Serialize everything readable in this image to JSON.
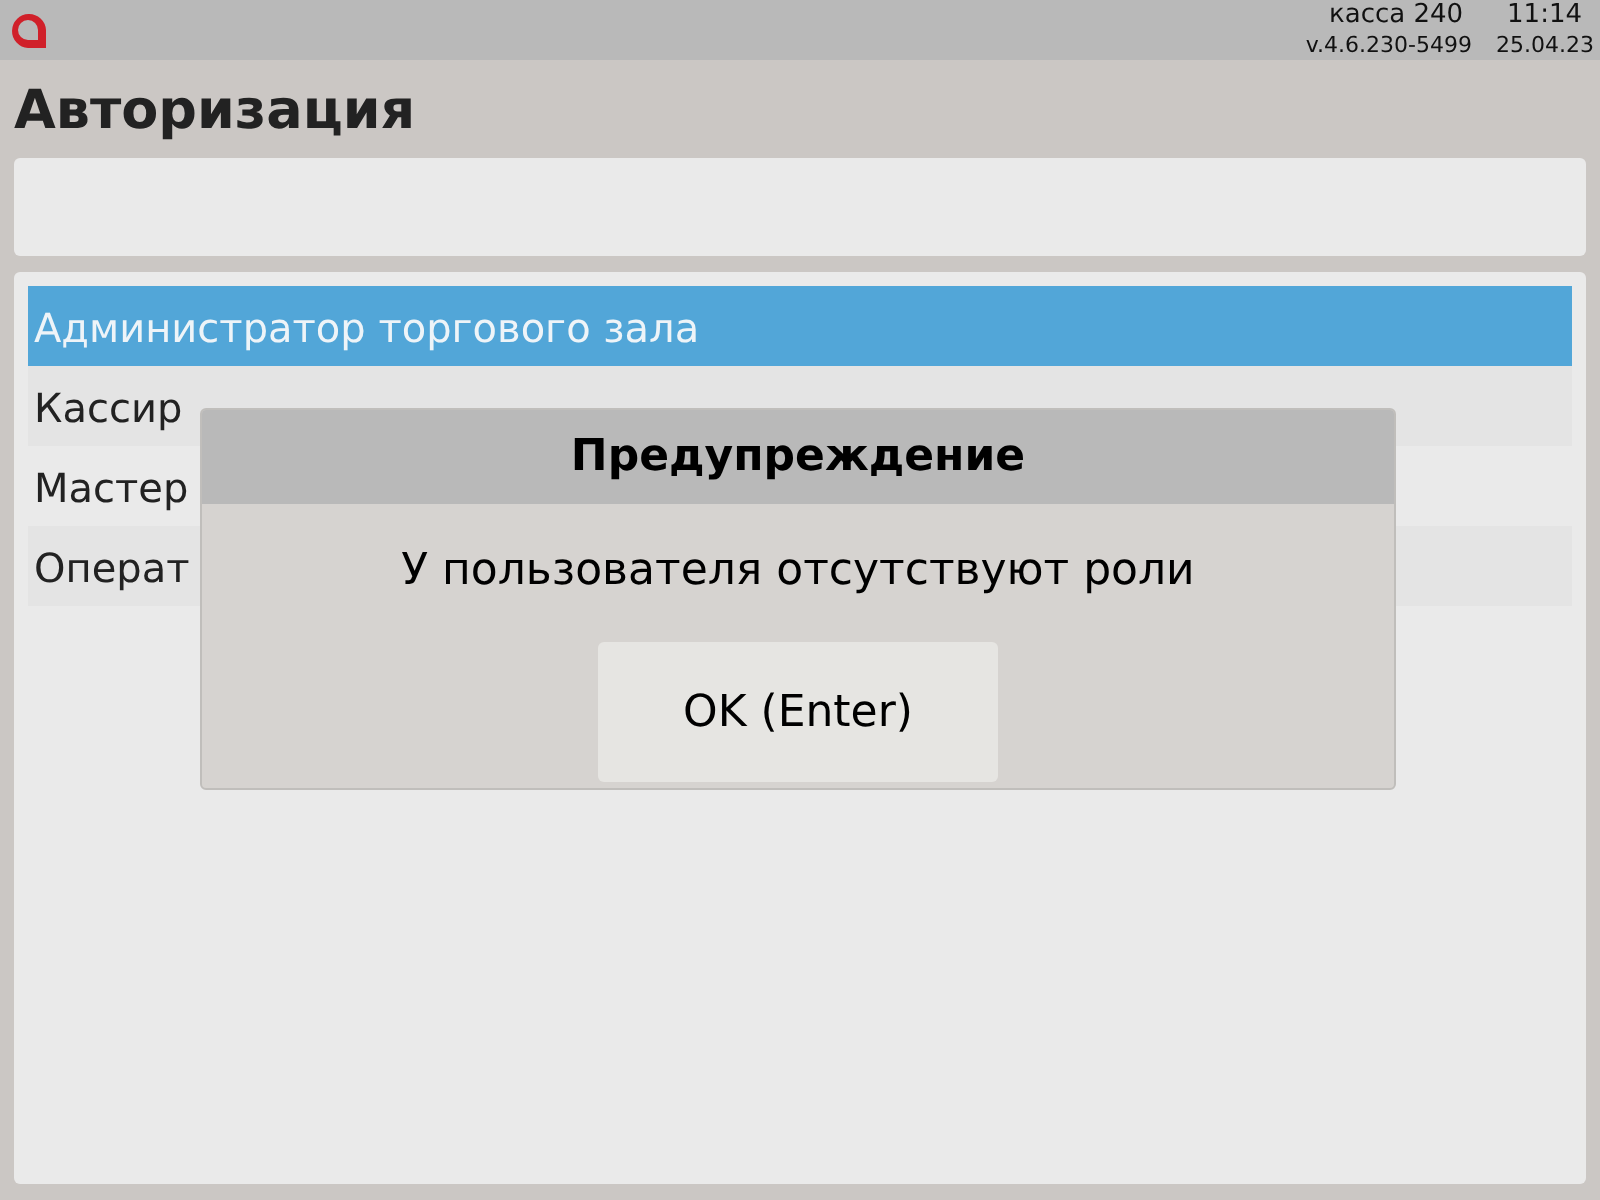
{
  "top_bar": {
    "register": "касса 240",
    "time": "11:14",
    "version": "v.4.6.230-5499",
    "date": "25.04.23"
  },
  "title": "Авторизация",
  "roles": [
    {
      "label": "Администратор торгового зала",
      "selected": true
    },
    {
      "label": "Кассир",
      "selected": false
    },
    {
      "label": "Мастер",
      "selected": false
    },
    {
      "label": "Операт",
      "selected": false
    }
  ],
  "dialog": {
    "title": "Предупреждение",
    "message": "У пользователя отсутствуют роли",
    "button": "OK (Enter)"
  }
}
